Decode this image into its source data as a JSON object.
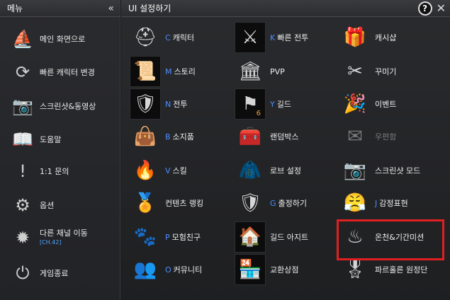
{
  "left_panel": {
    "title": "메뉴",
    "collapse_icon": "double-chevron-left",
    "items": [
      {
        "label": "메인 화면으로",
        "icon": "ship-icon"
      },
      {
        "label": "빠른 캐릭터 변경",
        "icon": "character-swap-icon"
      },
      {
        "label": "스크린샷&동영상",
        "icon": "camera-icon"
      },
      {
        "label": "도움말",
        "icon": "book-icon"
      },
      {
        "label": "1:1 문의",
        "icon": "exclamation-icon"
      },
      {
        "label": "옵션",
        "icon": "gears-icon"
      },
      {
        "label": "다른 채널 이동",
        "sub": "[CH.42]",
        "icon": "gear-channel-icon"
      },
      {
        "label": "게임종료",
        "icon": "power-icon"
      }
    ]
  },
  "main_panel": {
    "title": "UI 설정하기",
    "help_label": "?",
    "close_label": "✕",
    "items": [
      {
        "hotkey": "C",
        "label": "캐릭터",
        "icon": "helmet-icon"
      },
      {
        "hotkey": "K",
        "label": "빠른 전투",
        "icon": "fast-battle-icon"
      },
      {
        "hotkey": "",
        "label": "캐시샵",
        "icon": "gift-icon"
      },
      {
        "hotkey": "M",
        "label": "스토리",
        "icon": "scroll-icon"
      },
      {
        "hotkey": "",
        "label": "PVP",
        "icon": "colosseum-icon"
      },
      {
        "hotkey": "",
        "label": "꾸미기",
        "icon": "scissors-icon"
      },
      {
        "hotkey": "N",
        "label": "전투",
        "icon": "shield-icon"
      },
      {
        "hotkey": "Y",
        "label": "길드",
        "icon": "flag-icon",
        "badge": "6"
      },
      {
        "hotkey": "",
        "label": "이벤트",
        "icon": "party-popper-icon"
      },
      {
        "hotkey": "B",
        "label": "소지품",
        "icon": "bag-icon"
      },
      {
        "hotkey": "",
        "label": "랜덤박스",
        "icon": "chest-icon"
      },
      {
        "hotkey": "",
        "label": "우편함",
        "icon": "mail-icon",
        "disabled": true
      },
      {
        "hotkey": "V",
        "label": "스킬",
        "icon": "flame-skill-icon"
      },
      {
        "hotkey": "",
        "label": "로브 설정",
        "icon": "robe-icon"
      },
      {
        "hotkey": "",
        "label": "스크린샷 모드",
        "icon": "camera-icon"
      },
      {
        "hotkey": "",
        "label": "컨텐츠 랭킹",
        "icon": "ranking-medal-icon"
      },
      {
        "hotkey": "G",
        "label": "출정하기",
        "icon": "crest-icon"
      },
      {
        "hotkey": "J",
        "label": "감정표현",
        "icon": "emote-face-icon"
      },
      {
        "hotkey": "P",
        "label": "모험친구",
        "icon": "companion-icon"
      },
      {
        "hotkey": "",
        "label": "길드 아지트",
        "icon": "hideout-icon"
      },
      {
        "hotkey": "",
        "label": "온천&기간미션",
        "icon": "hot-spring-icon"
      },
      {
        "hotkey": "O",
        "label": "커뮤니티",
        "icon": "people-icon"
      },
      {
        "hotkey": "",
        "label": "교환상점",
        "icon": "shop-awning-icon"
      },
      {
        "hotkey": "",
        "label": "파르홀른 원정단",
        "icon": "expedition-badge-icon"
      }
    ]
  },
  "highlight_color": "#e02020"
}
